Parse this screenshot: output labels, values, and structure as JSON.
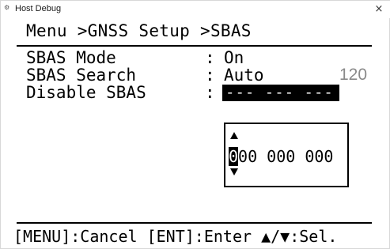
{
  "window": {
    "title": "Host Debug",
    "icon": "gear-app-icon",
    "close_label": "×"
  },
  "menu": {
    "breadcrumb": "Menu >GNSS Setup >SBAS"
  },
  "settings": [
    {
      "label": "SBAS Mode",
      "colon": ":",
      "value": "On"
    },
    {
      "label": "SBAS Search",
      "colon": ":",
      "value": "Auto",
      "extra": "120"
    },
    {
      "label": "Disable SBAS",
      "colon": ":",
      "value": "--- --- ---"
    }
  ],
  "popup": {
    "cursor_digit": "0",
    "rest_value": "00 000 000"
  },
  "footer": {
    "hint": "[MENU]:Cancel [ENT]:Enter ▲/▼:Sel."
  }
}
